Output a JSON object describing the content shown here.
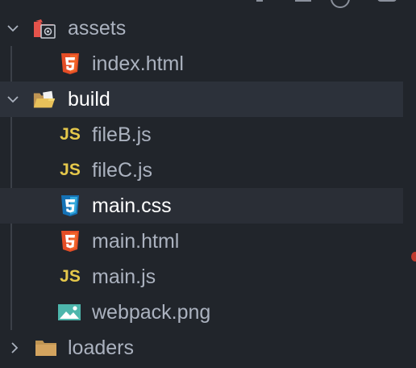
{
  "explorer": {
    "items": [
      {
        "label": "assets",
        "kind": "folder",
        "expanded": true,
        "icon": "assets-folder-icon"
      },
      {
        "label": "index.html",
        "kind": "file",
        "icon": "html5-icon"
      },
      {
        "label": "build",
        "kind": "folder",
        "expanded": true,
        "icon": "open-folder-icon",
        "selected": true
      },
      {
        "label": "fileB.js",
        "kind": "file",
        "icon": "js-icon"
      },
      {
        "label": "fileC.js",
        "kind": "file",
        "icon": "js-icon"
      },
      {
        "label": "main.css",
        "kind": "file",
        "icon": "css3-icon",
        "hovered": true
      },
      {
        "label": "main.html",
        "kind": "file",
        "icon": "html5-icon"
      },
      {
        "label": "main.js",
        "kind": "file",
        "icon": "js-icon"
      },
      {
        "label": "webpack.png",
        "kind": "file",
        "icon": "image-icon"
      },
      {
        "label": "loaders",
        "kind": "folder",
        "expanded": false,
        "icon": "folder-icon"
      }
    ],
    "badges": {
      "js": "JS"
    }
  },
  "colors": {
    "background": "#21252b",
    "selected_row": "#2c313a",
    "text": "#abb2bf",
    "text_active": "#ffffff",
    "html_orange": "#e44d26",
    "css_blue": "#1572b6",
    "js_yellow": "#e5c84b",
    "image_teal": "#4db6ac",
    "folder_tan": "#c09553"
  }
}
